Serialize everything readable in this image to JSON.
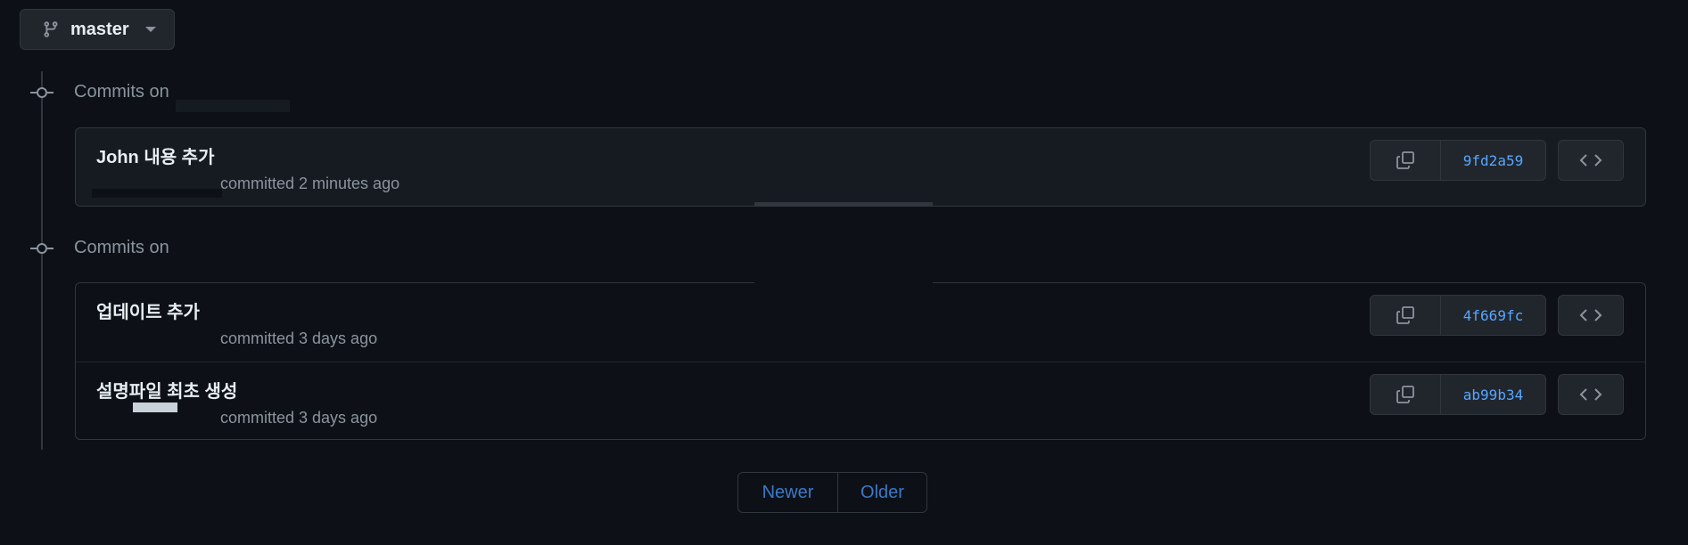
{
  "branch": {
    "name": "master"
  },
  "groups": [
    {
      "heading": "Commits on",
      "commits": [
        {
          "title": "John 내용 추가",
          "meta": "committed 2 minutes ago",
          "sha": "9fd2a59"
        }
      ]
    },
    {
      "heading": "Commits on",
      "commits": [
        {
          "title": "업데이트 추가",
          "meta": "committed 3 days ago",
          "sha": "4f669fc"
        },
        {
          "title": "설명파일 최초 생성",
          "meta": "committed 3 days ago",
          "sha": "ab99b34"
        }
      ]
    }
  ],
  "pagination": {
    "newer": "Newer",
    "older": "Older"
  }
}
